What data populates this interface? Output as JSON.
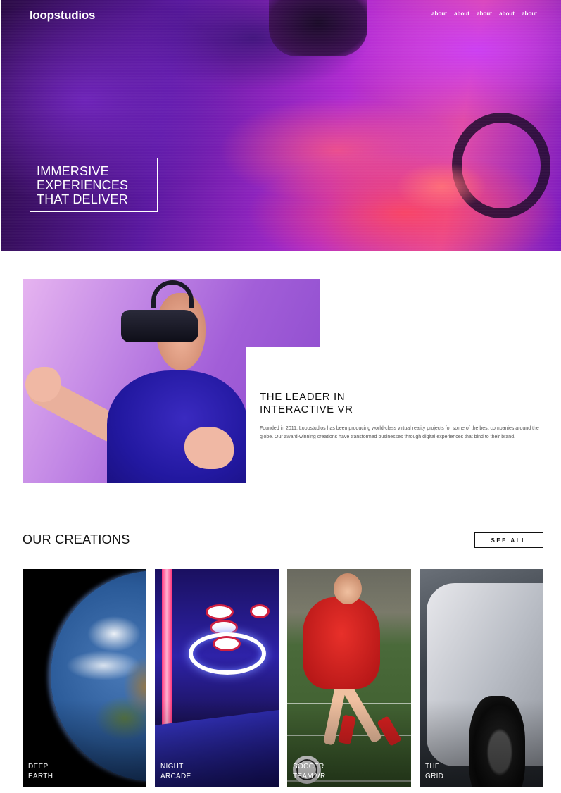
{
  "header": {
    "logo": "loopstudios",
    "nav": [
      "about",
      "about",
      "about",
      "about",
      "about"
    ]
  },
  "hero": {
    "headline_lines": [
      "IMMERSIVE",
      "EXPERIENCES",
      "THAT DELIVER"
    ]
  },
  "about": {
    "title_lines": [
      "THE LEADER IN",
      "INTERACTIVE VR"
    ],
    "body": "Founded in 2011, Loopstudios has been producing world-class virtual reality projects for some of the best companies around the globe. Our award-winning creations have transformed businesses through digital experiences that bind to their brand."
  },
  "creations": {
    "title": "OUR CREATIONS",
    "see_all": "SEE ALL",
    "cards": [
      {
        "line1": "DEEP",
        "line2": "EARTH"
      },
      {
        "line1": "NIGHT",
        "line2": "ARCADE"
      },
      {
        "line1": "SOCCER",
        "line2": "TEAM VR"
      },
      {
        "line1": "THE",
        "line2": "GRID"
      }
    ]
  },
  "colors": {
    "hero_purple": "#5a18a0",
    "hero_pink": "#e04aa8",
    "text_dark": "#111111",
    "text_muted": "#555555"
  }
}
